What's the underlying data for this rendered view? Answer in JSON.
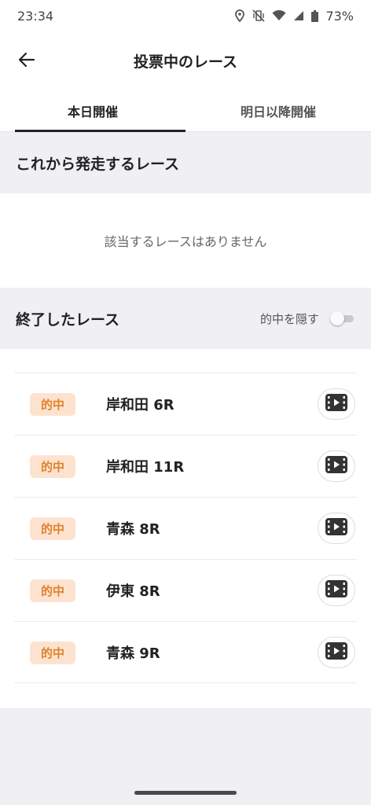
{
  "status_bar": {
    "time": "23:34",
    "battery": "73%",
    "icons": [
      "location-icon",
      "vibrate-off-icon",
      "wifi-icon",
      "signal-icon",
      "battery-icon"
    ]
  },
  "header": {
    "title": "投票中のレース",
    "back_icon": "arrow-left-icon"
  },
  "tabs": [
    {
      "label": "本日開催",
      "active": true
    },
    {
      "label": "明日以降開催",
      "active": false
    }
  ],
  "upcoming": {
    "title": "これから発走するレース",
    "empty_message": "該当するレースはありません"
  },
  "finished": {
    "title": "終了したレース",
    "hide_hits_label": "的中を隠す",
    "hide_hits_on": false,
    "races": [
      {
        "badge": "的中",
        "name": "岸和田 6R"
      },
      {
        "badge": "的中",
        "name": "岸和田 11R"
      },
      {
        "badge": "的中",
        "name": "青森 8R"
      },
      {
        "badge": "的中",
        "name": "伊東 8R"
      },
      {
        "badge": "的中",
        "name": "青森 9R"
      }
    ]
  },
  "colors": {
    "accent_orange": "#e0822c",
    "badge_bg": "#fde3cf",
    "section_bg": "#f0eff4"
  }
}
